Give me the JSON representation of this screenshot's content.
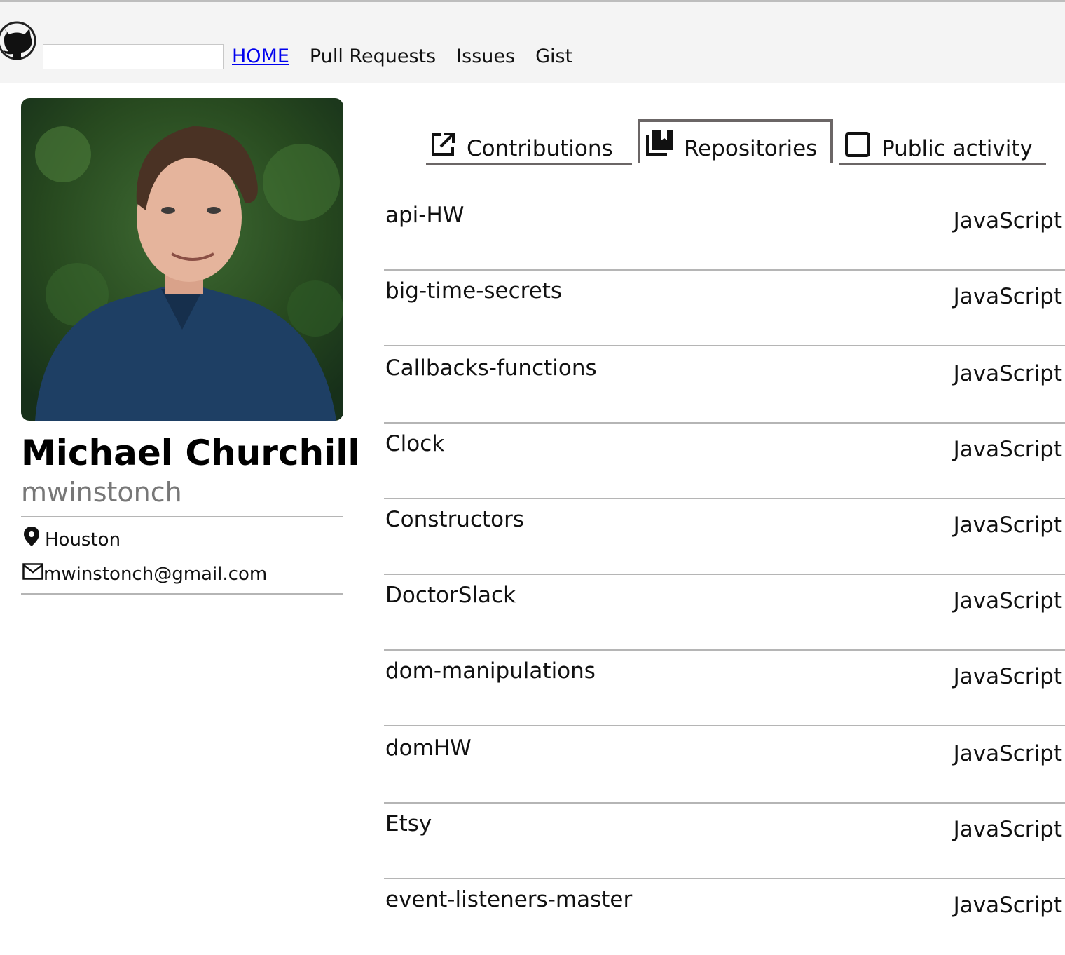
{
  "header": {
    "search": {
      "value": "",
      "placeholder": ""
    },
    "nav": [
      {
        "label": "HOME"
      },
      {
        "label": "Pull Requests"
      },
      {
        "label": "Issues"
      },
      {
        "label": "Gist"
      }
    ]
  },
  "profile": {
    "name": "Michael Churchill",
    "username": "mwinstonch",
    "location": "Houston",
    "email": "mwinstonch@gmail.com"
  },
  "tabs": [
    {
      "label": "Contributions",
      "icon": "external-link-icon"
    },
    {
      "label": "Repositories",
      "icon": "repo-bookmark-icon",
      "active": true
    },
    {
      "label": "Public activity",
      "icon": "square-icon"
    }
  ],
  "repos": [
    {
      "name": "api-HW",
      "language": "JavaScript"
    },
    {
      "name": "big-time-secrets",
      "language": "JavaScript"
    },
    {
      "name": "Callbacks-functions",
      "language": "JavaScript"
    },
    {
      "name": "Clock",
      "language": "JavaScript"
    },
    {
      "name": "Constructors",
      "language": "JavaScript"
    },
    {
      "name": "DoctorSlack",
      "language": "JavaScript"
    },
    {
      "name": "dom-manipulations",
      "language": "JavaScript"
    },
    {
      "name": "domHW",
      "language": "JavaScript"
    },
    {
      "name": "Etsy",
      "language": "JavaScript"
    },
    {
      "name": "event-listeners-master",
      "language": "JavaScript"
    }
  ],
  "colors": {
    "link": "#0000ee",
    "divider": "#b5b5b5",
    "tab_border": "#6b6666",
    "username": "#777777"
  }
}
